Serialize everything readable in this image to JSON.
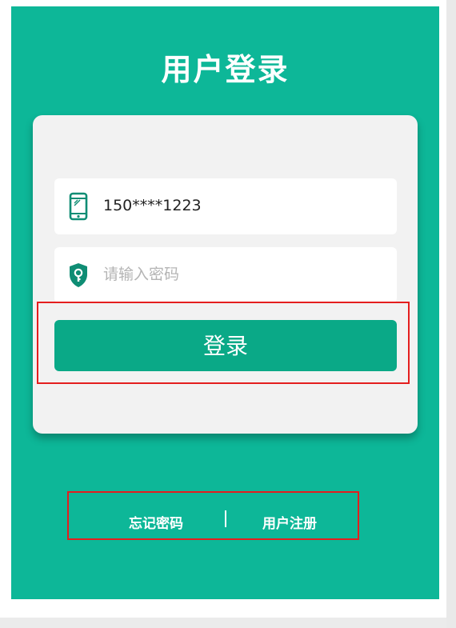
{
  "page": {
    "title": "用户登录"
  },
  "form": {
    "phone_value": "150****1223",
    "password_placeholder": "请输入密码",
    "login_label": "登录"
  },
  "links": {
    "forgot_password": "忘记密码",
    "register": "用户注册"
  },
  "icons": {
    "phone": "mobile-phone-icon",
    "password": "shield-key-icon"
  },
  "colors": {
    "background": "#0db798",
    "card": "#f2f2f2",
    "button": "#0aa987",
    "icon": "#0f8d74",
    "highlight": "#e41e1e"
  }
}
